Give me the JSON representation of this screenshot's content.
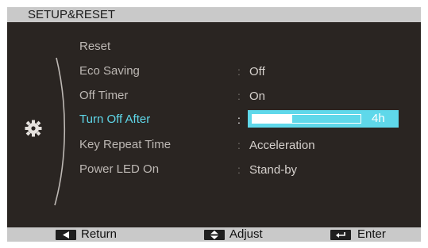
{
  "title": "SETUP&RESET",
  "menu": [
    {
      "label": "Reset",
      "value": "",
      "active": false
    },
    {
      "label": "Eco Saving",
      "value": "Off",
      "active": false
    },
    {
      "label": "Off Timer",
      "value": "On",
      "active": false
    },
    {
      "label": "Turn Off After",
      "value": "",
      "active": true
    },
    {
      "label": "Key Repeat Time",
      "value": "Acceleration",
      "active": false
    },
    {
      "label": "Power LED On",
      "value": "Stand-by",
      "active": false
    }
  ],
  "colon": ":",
  "slider": {
    "value_label": "4h",
    "fill_fraction": 0.37
  },
  "footer": {
    "return_label": "Return",
    "adjust_label": "Adjust",
    "enter_label": "Enter"
  },
  "icons": {
    "category": "gear-icon",
    "return": "left-arrow-icon",
    "adjust": "up-down-arrow-icon",
    "enter": "enter-icon"
  },
  "colors": {
    "highlight": "#5fd8ea",
    "background": "#2a2522",
    "bar": "#c9c9c9"
  }
}
